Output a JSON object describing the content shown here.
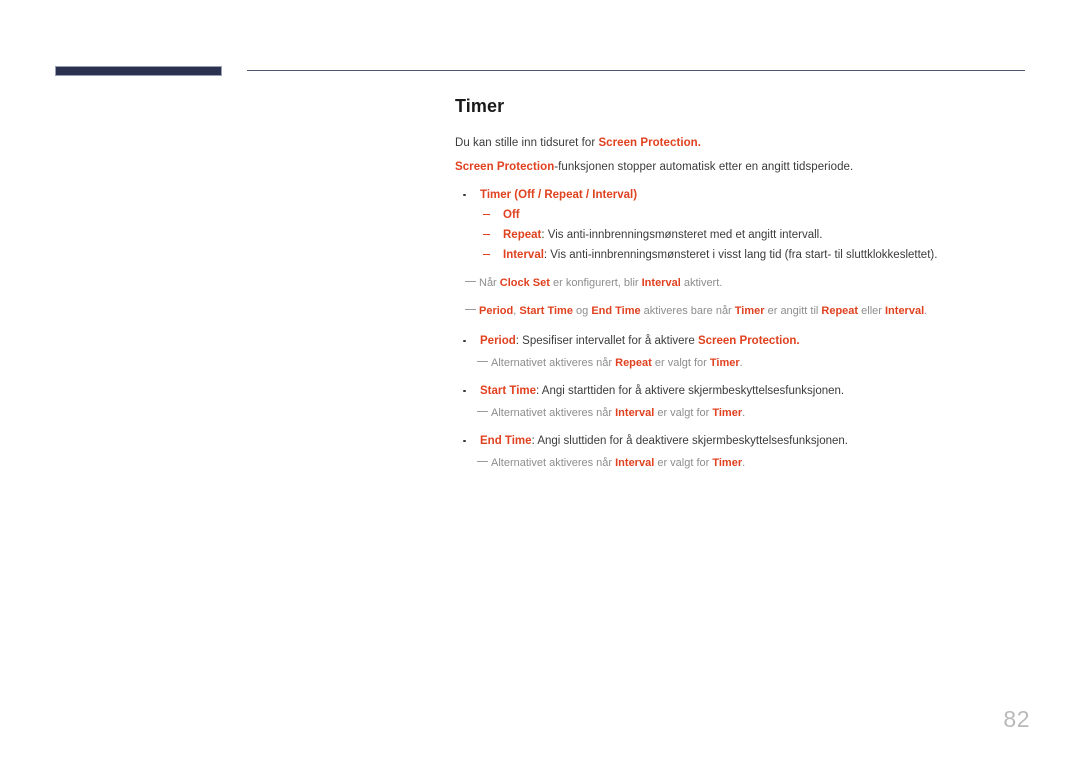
{
  "header": {
    "tab_color": "#2b3250",
    "rule_color": "#50546e"
  },
  "accent_color": "#e0411f",
  "page": {
    "title": "Timer",
    "number": "82"
  },
  "intro": {
    "line1_pre": "Du kan stille inn tidsuret for ",
    "line1_accent": "Screen Protection",
    "line1_post": ".",
    "line2_accent": "Screen Protection",
    "line2_post": "-funksjonen stopper automatisk etter en angitt tidsperiode."
  },
  "timer_item": {
    "label": "Timer",
    "paren_open": " (",
    "opt1": "Off",
    "sep1": " / ",
    "opt2": "Repeat",
    "sep2": " / ",
    "opt3": "Interval",
    "paren_close": ")"
  },
  "sub_items": [
    {
      "term": "Off",
      "desc": ""
    },
    {
      "term": "Repeat",
      "desc": ": Vis anti-innbrenningsmønsteret med et angitt intervall."
    },
    {
      "term": "Interval",
      "desc": ": Vis anti-innbrenningsmønsteret i visst lang tid (fra start- til sluttklokkeslettet)."
    }
  ],
  "notes_top": [
    {
      "pre": "Når ",
      "k1": "Clock Set",
      "mid": " er konfigurert, blir ",
      "k2": "Interval",
      "post": " aktivert."
    },
    {
      "k1": "Period",
      "c1": ", ",
      "k2": "Start Time",
      "c2": " og ",
      "k3": "End Time",
      "mid": " aktiveres bare når ",
      "k4": "Timer",
      "mid2": " er angitt til ",
      "k5": "Repeat",
      "mid3": " eller ",
      "k6": "Interval",
      "post": "."
    }
  ],
  "options": [
    {
      "term": "Period",
      "desc_pre": ": Spesifiser intervallet for å aktivere ",
      "desc_accent": "Screen Protection",
      "desc_post": ".",
      "note_pre": "Alternativet aktiveres når ",
      "note_k1": "Repeat",
      "note_mid": " er valgt for ",
      "note_k2": "Timer",
      "note_post": "."
    },
    {
      "term": "Start Time",
      "desc_pre": ": Angi starttiden for å aktivere skjermbeskyttelsesfunksjonen.",
      "desc_accent": "",
      "desc_post": "",
      "note_pre": "Alternativet aktiveres når ",
      "note_k1": "Interval",
      "note_mid": " er valgt for ",
      "note_k2": "Timer",
      "note_post": "."
    },
    {
      "term": "End Time",
      "desc_pre": ": Angi sluttiden for å deaktivere skjermbeskyttelsesfunksjonen.",
      "desc_accent": "",
      "desc_post": "",
      "note_pre": "Alternativet aktiveres når ",
      "note_k1": "Interval",
      "note_mid": " er valgt for ",
      "note_k2": "Timer",
      "note_post": "."
    }
  ]
}
